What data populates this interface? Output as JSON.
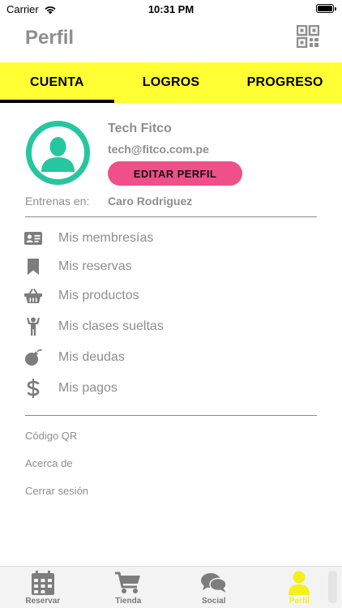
{
  "status_bar": {
    "carrier": "Carrier",
    "time": "10:31 PM"
  },
  "header": {
    "title": "Perfil",
    "qr_icon": "qr-code-icon"
  },
  "tabs": [
    {
      "label": "CUENTA",
      "active": true
    },
    {
      "label": "LOGROS",
      "active": false
    },
    {
      "label": "PROGRESO",
      "active": false
    }
  ],
  "profile": {
    "name": "Tech Fitco",
    "email": "tech@fitco.com.pe",
    "edit_button": "EDITAR PERFIL",
    "trainer_label": "Entrenas en:",
    "trainer_name": "Caro Rodriguez"
  },
  "menu": [
    {
      "label": "Mis membresías",
      "icon": "id-card-icon"
    },
    {
      "label": "Mis reservas",
      "icon": "bookmark-icon"
    },
    {
      "label": "Mis productos",
      "icon": "basket-icon"
    },
    {
      "label": "Mis clases sueltas",
      "icon": "person-arms-up-icon"
    },
    {
      "label": "Mis deudas",
      "icon": "bomb-icon"
    },
    {
      "label": "Mis pagos",
      "icon": "dollar-icon"
    }
  ],
  "links": [
    "Código QR",
    "Acerca de",
    "Cerrar sesión"
  ],
  "bottom_nav": [
    {
      "label": "Reservar",
      "icon": "calendar-icon",
      "active": false
    },
    {
      "label": "Tienda",
      "icon": "cart-icon",
      "active": false
    },
    {
      "label": "Social",
      "icon": "chat-bubbles-icon",
      "active": false
    },
    {
      "label": "Perfil",
      "icon": "user-icon",
      "active": true
    }
  ],
  "colors": {
    "tab_bar": "#ffff33",
    "avatar_ring": "#26c6a0",
    "edit_button": "#f0508a",
    "active_nav": "#f5ef1a",
    "text_muted": "#8e8e8e"
  }
}
